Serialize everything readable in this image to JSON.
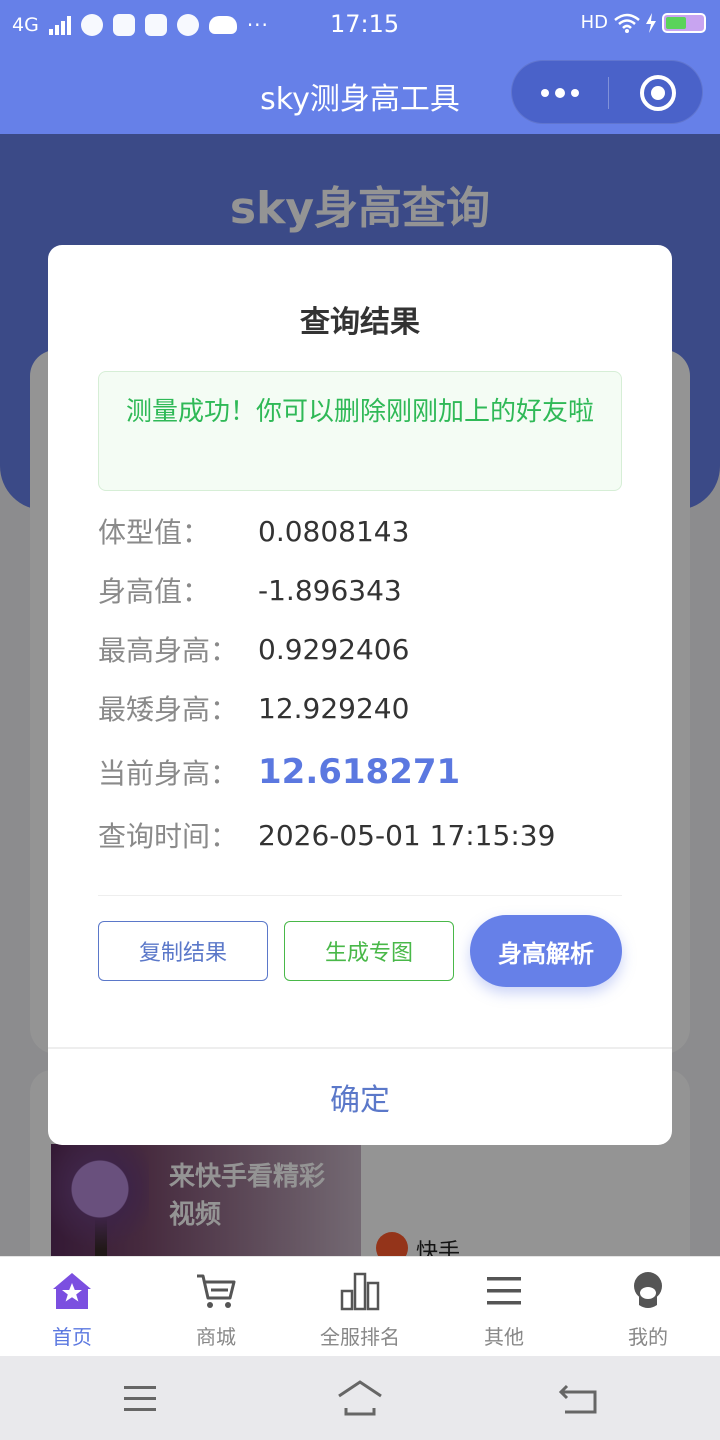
{
  "status_bar": {
    "network": "4G",
    "time": "17:15",
    "hd": "HD",
    "more_dots": "···",
    "battery_level": 0.55
  },
  "title_bar": {
    "title": "sky测身高工具",
    "more_icon": "more-dots-icon",
    "close_icon": "target-close-icon"
  },
  "page": {
    "hero_title": "sky身高查询"
  },
  "ad": {
    "text": "来快手看精彩视频",
    "stars": "★★★★★",
    "brand": "快手"
  },
  "modal": {
    "title": "查询结果",
    "success_message": "测量成功！你可以删除刚刚加上的好友啦",
    "rows": [
      {
        "label": "体型值：",
        "value": "0.0808143"
      },
      {
        "label": "身高值：",
        "value": "-1.896343"
      },
      {
        "label": "最高身高：",
        "value": "0.9292406"
      },
      {
        "label": "最矮身高：",
        "value": "12.929240"
      },
      {
        "label": "当前身高：",
        "value": "12.618271"
      },
      {
        "label": "查询时间：",
        "value": "2026-05-01 17:15:39"
      }
    ],
    "buttons": {
      "copy": "复制结果",
      "generate": "生成专图",
      "analyze": "身高解析"
    },
    "ok": "确定"
  },
  "tabs": [
    {
      "label": "首页",
      "icon": "home-star-icon",
      "active": true
    },
    {
      "label": "商城",
      "icon": "cart-icon",
      "active": false
    },
    {
      "label": "全服排名",
      "icon": "bar-chart-icon",
      "active": false
    },
    {
      "label": "其他",
      "icon": "menu-icon",
      "active": false
    },
    {
      "label": "我的",
      "icon": "profile-icon",
      "active": false
    }
  ],
  "colors": {
    "primary": "#6680e8",
    "success": "#2fb957",
    "green_button": "#49b849",
    "value_highlight": "#5b78e0"
  }
}
